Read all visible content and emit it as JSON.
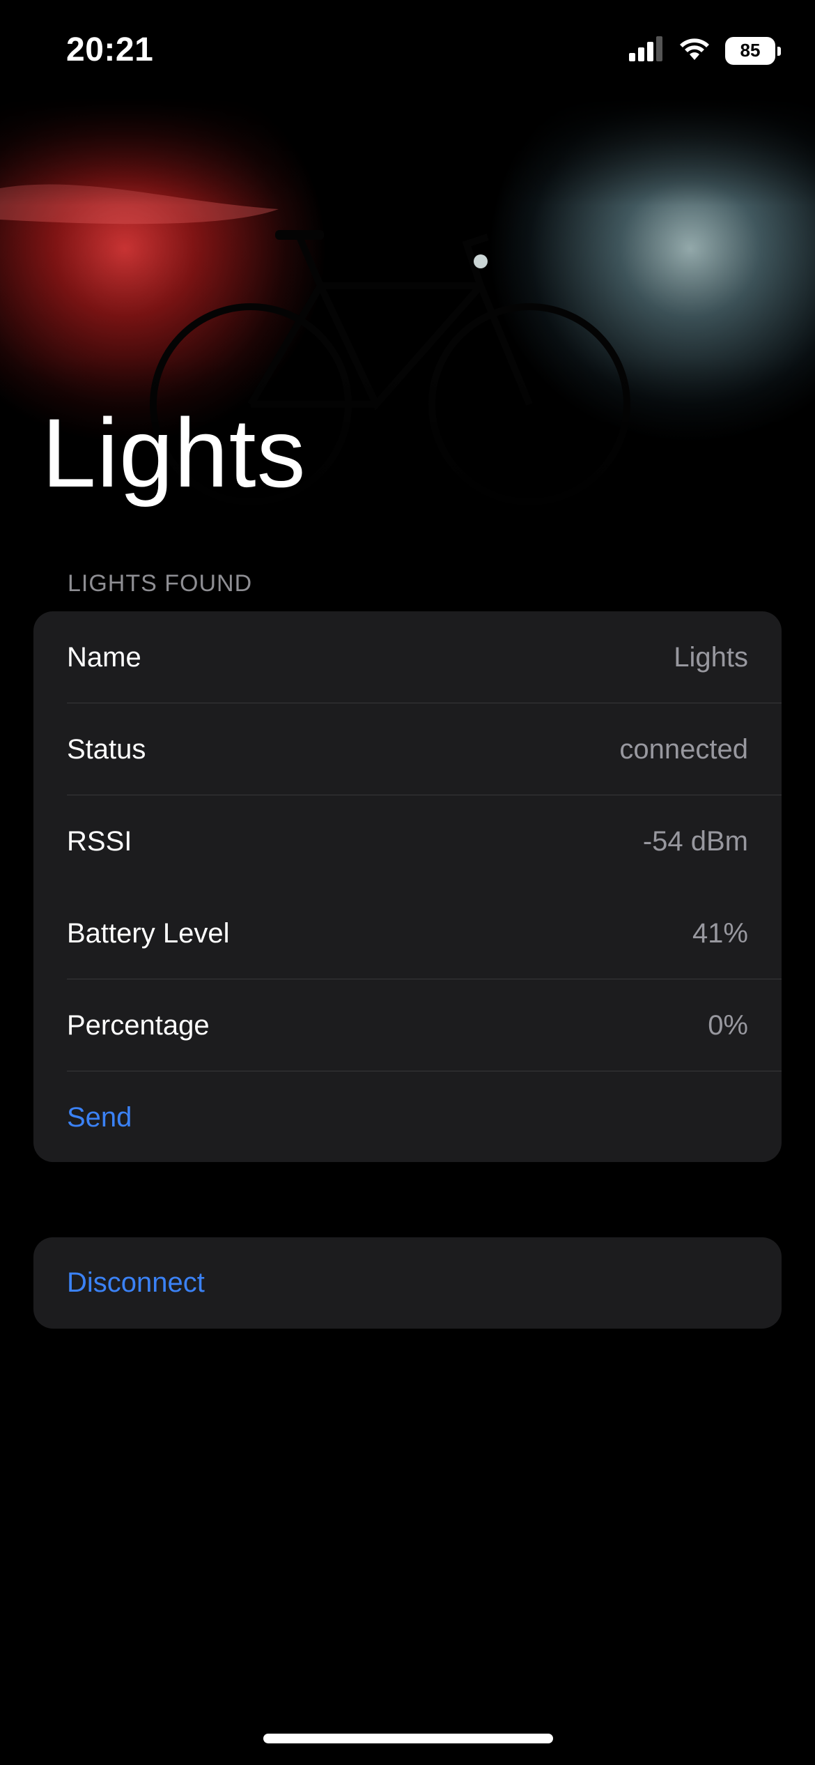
{
  "status_bar": {
    "time": "20:21",
    "battery": "85",
    "icons": [
      "cellular-signal-icon",
      "wifi-icon",
      "battery-icon"
    ]
  },
  "hero": {
    "title": "Lights",
    "image": "bicycle-with-red-and-white-lights"
  },
  "section": {
    "header": "LIGHTS FOUND",
    "rows": [
      {
        "label": "Name",
        "value": "Lights"
      },
      {
        "label": "Status",
        "value": "connected"
      },
      {
        "label": "RSSI",
        "value": "-54 dBm"
      },
      {
        "label": "Battery Level",
        "value": "41%"
      },
      {
        "label": "Percentage",
        "value": "0%"
      }
    ],
    "send_label": "Send"
  },
  "actions": {
    "disconnect_label": "Disconnect"
  },
  "colors": {
    "background": "#000000",
    "card": "#1c1c1e",
    "accent": "#3b82f6",
    "secondary_text": "#98989f"
  }
}
